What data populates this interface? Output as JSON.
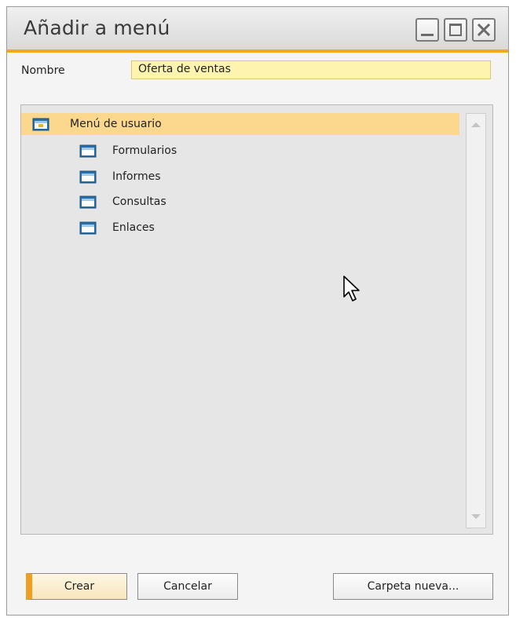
{
  "window": {
    "title": "Añadir a menú",
    "controls": {
      "minimize_icon": "minimize-icon",
      "maximize_icon": "maximize-icon",
      "close_icon": "close-icon"
    },
    "accent_color": "#f0aa16"
  },
  "form": {
    "name_label": "Nombre",
    "name_value": "Oferta de ventas",
    "input_bg": "#fff3b0"
  },
  "tree": {
    "root": {
      "label": "Menú de usuario",
      "icon": "folder-icon",
      "selected": true
    },
    "children": [
      {
        "label": "Formularios",
        "icon": "folder-icon"
      },
      {
        "label": "Informes",
        "icon": "folder-icon"
      },
      {
        "label": "Consultas",
        "icon": "folder-icon"
      },
      {
        "label": "Enlaces",
        "icon": "folder-icon"
      }
    ],
    "selection_color": "#fbd88e"
  },
  "buttons": {
    "create": "Crear",
    "cancel": "Cancelar",
    "new_folder": "Carpeta nueva..."
  }
}
